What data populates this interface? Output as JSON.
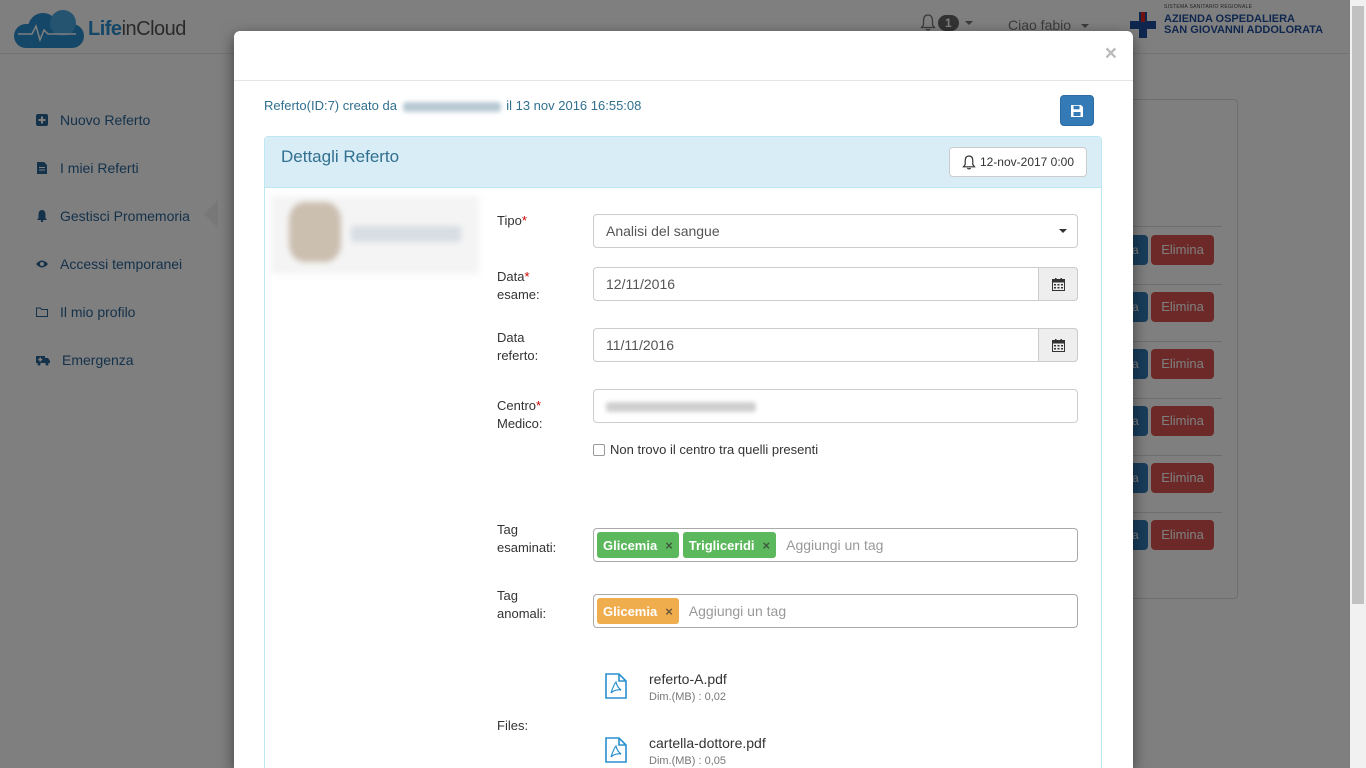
{
  "app": {
    "logo_text_a": "Life",
    "logo_text_b": "in",
    "logo_text_c": "Cloud"
  },
  "navbar": {
    "notifications_count": "1",
    "user_greeting": "Ciao fabio",
    "hospital_small": "SISTEMA SANITARIO REGIONALE",
    "hospital_line1": "AZIENDA OSPEDALIERA",
    "hospital_line2": "SAN GIOVANNI ADDOLORATA"
  },
  "sidebar": {
    "items": [
      {
        "label": "Nuovo Referto",
        "icon": "plus-square-icon"
      },
      {
        "label": "I miei Referti",
        "icon": "file-icon"
      },
      {
        "label": "Gestisci Promemoria",
        "icon": "bell-icon"
      },
      {
        "label": "Accessi temporanei",
        "icon": "eye-icon"
      },
      {
        "label": "Il mio profilo",
        "icon": "folder-icon"
      },
      {
        "label": "Emergenza",
        "icon": "ambulance-icon"
      }
    ]
  },
  "background_list": {
    "delete_label": "Elimina",
    "edit_label": "a",
    "rows": 6
  },
  "modal": {
    "close": "×",
    "created_prefix": "Referto(ID:7) creato da",
    "created_suffix": "il 13 nov 2016 16:55:08",
    "panel_title": "Dettagli Referto",
    "reminder_date": "12-nov-2017 0:00",
    "form": {
      "tipo_label": "Tipo",
      "tipo_value": "Analisi del sangue",
      "data_esame_label_1": "Data",
      "data_esame_label_2": "esame:",
      "data_esame_value": "12/11/2016",
      "data_referto_label_1": "Data",
      "data_referto_label_2": "referto:",
      "data_referto_value": "11/11/2016",
      "centro_label_1": "Centro",
      "centro_label_2": "Medico:",
      "checkbox_label": "Non trovo il centro tra quelli presenti",
      "tag_esaminati_label_1": "Tag",
      "tag_esaminati_label_2": "esaminati:",
      "tags_esaminati": [
        "Glicemia",
        "Trigliceridi"
      ],
      "tag_placeholder": "Aggiungi un tag",
      "tag_anomali_label_1": "Tag",
      "tag_anomali_label_2": "anomali:",
      "tags_anomali": [
        "Glicemia"
      ],
      "files_label": "Files:",
      "files": [
        {
          "name": "referto-A.pdf",
          "size": "Dim.(MB) : 0,02"
        },
        {
          "name": "cartella-dottore.pdf",
          "size": "Dim.(MB) : 0,05"
        }
      ]
    }
  },
  "colors": {
    "primary": "#337ab7",
    "danger": "#d9534f",
    "success": "#5cb85c",
    "warning": "#f0ad4e",
    "info_bg": "#d9edf7"
  }
}
